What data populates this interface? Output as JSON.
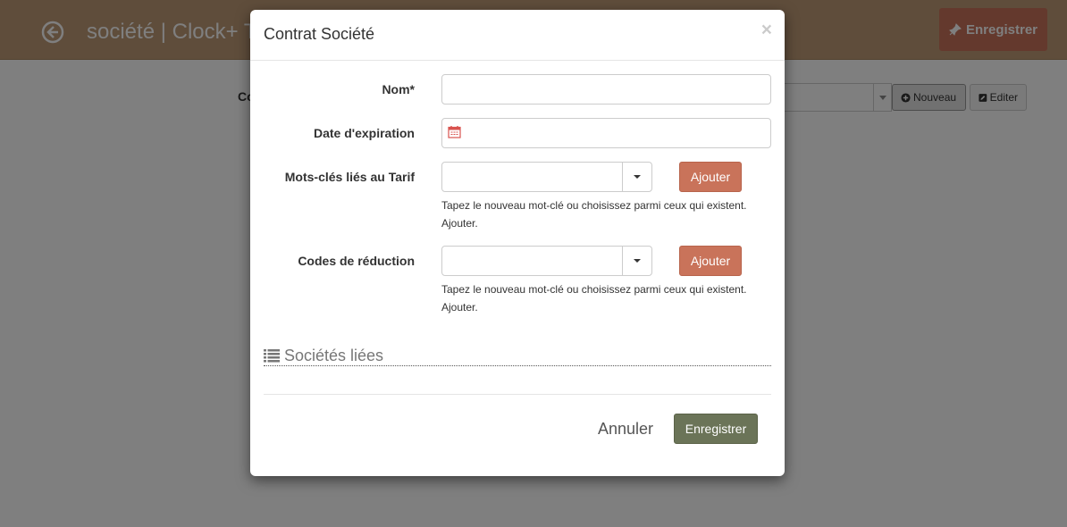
{
  "page": {
    "title": "société | Clock+ T",
    "save_button": "Enregistrer",
    "field_label": "Co",
    "new_button": "Nouveau",
    "edit_button": "Editer"
  },
  "modal": {
    "title": "Contrat Société",
    "close": "×",
    "fields": {
      "name_label": "Nom*",
      "name_value": "",
      "expiration_label": "Date d'expiration",
      "expiration_value": "",
      "keywords_label": "Mots-clés liés au Tarif",
      "keywords_value": "",
      "keywords_add": "Ajouter",
      "keywords_help": "Tapez le nouveau mot-clé ou choisissez parmi ceux qui existent. Ajouter.",
      "discount_label": "Codes de réduction",
      "discount_value": "",
      "discount_add": "Ajouter",
      "discount_help": "Tapez le nouveau mot-clé ou choisissez parmi ceux qui existent. Ajouter."
    },
    "section_title": "Sociétés liées",
    "cancel_button": "Annuler",
    "save_button": "Enregistrer"
  },
  "colors": {
    "header_bg": "#bf9a77",
    "accent_button": "#c9735a",
    "primary_button": "#6b7458"
  }
}
